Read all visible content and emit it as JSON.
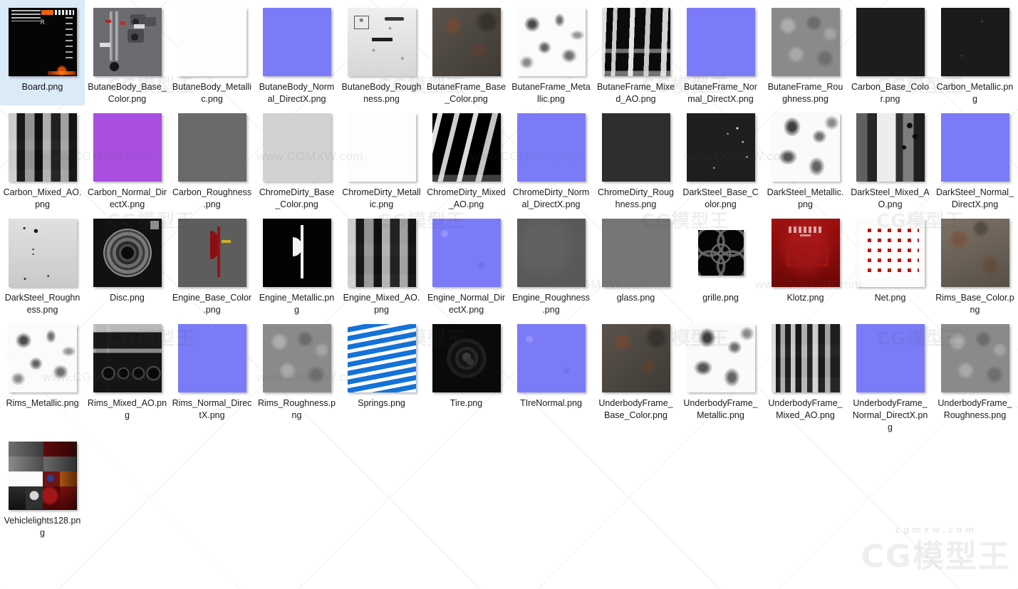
{
  "window": {
    "title": "Texture folder — icon view",
    "background": "#ffffff",
    "selection_color": "#dbeaf7"
  },
  "watermark": {
    "logo_text": "CG模型王",
    "logo_sub": "cgmxw.com",
    "tiles": [
      "CG模型王",
      "CG模型王",
      "CG模型王",
      "CG模型王",
      "CG模型王",
      "CG模型王",
      "CG模型王",
      "CG模型王",
      "CG模型王",
      "CG模型王",
      "CG模型王",
      "CG模型王"
    ],
    "urls": [
      "www.CGMXW.com",
      "www.CGMXW.com",
      "www.CGMXW.com",
      "www.CGMXW.com",
      "www.CGMXW.com",
      "www.CGMXW.com",
      "www.CGMXW.com",
      "www.CGMXW.com"
    ]
  },
  "files": [
    {
      "name": "Board.png",
      "selected": true,
      "thumb": "tx-board",
      "shape": "square"
    },
    {
      "name": "ButaneBody_Base_Color.png",
      "selected": false,
      "thumb": "tx-bbasecolor",
      "shape": "square"
    },
    {
      "name": "ButaneBody_Metallic.png",
      "selected": false,
      "thumb": "tx-white",
      "shape": "square"
    },
    {
      "name": "ButaneBody_Normal_DirectX.png",
      "selected": false,
      "thumb": "tx-normal",
      "shape": "square"
    },
    {
      "name": "ButaneBody_Roughness.png",
      "selected": false,
      "thumb": "tx-grunge-light",
      "shape": "square"
    },
    {
      "name": "ButaneFrame_Base_Color.png",
      "selected": false,
      "thumb": "tx-rust-dark",
      "shape": "square"
    },
    {
      "name": "ButaneFrame_Metallic.png",
      "selected": false,
      "thumb": "tx-speckle-white",
      "shape": "square"
    },
    {
      "name": "ButaneFrame_Mixed_AO.png",
      "selected": false,
      "thumb": "tx-ao-frame",
      "shape": "square"
    },
    {
      "name": "ButaneFrame_Normal_DirectX.png",
      "selected": false,
      "thumb": "tx-normal",
      "shape": "square"
    },
    {
      "name": "ButaneFrame_Roughness.png",
      "selected": false,
      "thumb": "tx-mid-rough",
      "shape": "square"
    },
    {
      "name": "Carbon_Base_Color.png",
      "selected": false,
      "thumb": "tx-near-black",
      "shape": "square"
    },
    {
      "name": "Carbon_Metallic.png",
      "selected": false,
      "thumb": "tx-near-black2",
      "shape": "square"
    },
    {
      "name": "Carbon_Mixed_AO.png",
      "selected": false,
      "thumb": "tx-ao-blocks",
      "shape": "square"
    },
    {
      "name": "Carbon_Normal_DirectX.png",
      "selected": false,
      "thumb": "tx-purple",
      "shape": "square"
    },
    {
      "name": "Carbon_Roughness.png",
      "selected": false,
      "thumb": "tx-gray-flat2",
      "shape": "square"
    },
    {
      "name": "ChromeDirty_Base_Color.png",
      "selected": false,
      "thumb": "tx-chrome-base",
      "shape": "square"
    },
    {
      "name": "ChromeDirty_Metallic.png",
      "selected": false,
      "thumb": "tx-white",
      "shape": "square"
    },
    {
      "name": "ChromeDirty_Mixed_AO.png",
      "selected": false,
      "thumb": "tx-ao-chrome",
      "shape": "square"
    },
    {
      "name": "ChromeDirty_Normal_DirectX.png",
      "selected": false,
      "thumb": "tx-normal",
      "shape": "square"
    },
    {
      "name": "ChromeDirty_Roughness.png",
      "selected": false,
      "thumb": "tx-gray-darkflat",
      "shape": "square"
    },
    {
      "name": "DarkSteel_Base_Color.png",
      "selected": false,
      "thumb": "tx-dk-speck",
      "shape": "square"
    },
    {
      "name": "DarkSteel_Metallic.png",
      "selected": false,
      "thumb": "tx-speckle-white2",
      "shape": "square"
    },
    {
      "name": "DarkSteel_Mixed_AO.png",
      "selected": false,
      "thumb": "tx-ao-darksteel",
      "shape": "square"
    },
    {
      "name": "DarkSteel_Normal_DirectX.png",
      "selected": false,
      "thumb": "tx-normal",
      "shape": "square"
    },
    {
      "name": "DarkSteel_Roughness.png",
      "selected": false,
      "thumb": "tx-offwhite-dots",
      "shape": "square"
    },
    {
      "name": "Disc.png",
      "selected": false,
      "thumb": "tx-disc",
      "shape": "square"
    },
    {
      "name": "Engine_Base_Color.png",
      "selected": false,
      "thumb": "tx-engine-base",
      "shape": "square"
    },
    {
      "name": "Engine_Metallic.png",
      "selected": false,
      "thumb": "tx-engine-metal",
      "shape": "square"
    },
    {
      "name": "Engine_Mixed_AO.png",
      "selected": false,
      "thumb": "tx-ao-blocks",
      "shape": "square"
    },
    {
      "name": "Engine_Normal_DirectX.png",
      "selected": false,
      "thumb": "tx-normal-noisy",
      "shape": "square"
    },
    {
      "name": "Engine_Roughness.png",
      "selected": false,
      "thumb": "tx-gray-dark2",
      "shape": "square"
    },
    {
      "name": "glass.png",
      "selected": false,
      "thumb": "tx-glass",
      "shape": "square"
    },
    {
      "name": "grille.png",
      "selected": false,
      "thumb": "tx-grille",
      "shape": "small"
    },
    {
      "name": "Klotz.png",
      "selected": false,
      "thumb": "tx-klotz",
      "shape": "square"
    },
    {
      "name": "Net.png",
      "selected": false,
      "thumb": "tx-net",
      "shape": "square"
    },
    {
      "name": "Rims_Base_Color.png",
      "selected": false,
      "thumb": "tx-rust-mid",
      "shape": "square"
    },
    {
      "name": "Rims_Metallic.png",
      "selected": false,
      "thumb": "tx-speckle-white",
      "shape": "square"
    },
    {
      "name": "Rims_Mixed_AO.png",
      "selected": false,
      "thumb": "tx-ao-rims",
      "shape": "square"
    },
    {
      "name": "Rims_Normal_DirectX.png",
      "selected": false,
      "thumb": "tx-normal",
      "shape": "square"
    },
    {
      "name": "Rims_Roughness.png",
      "selected": false,
      "thumb": "tx-mid-rough",
      "shape": "square"
    },
    {
      "name": "Springs.png",
      "selected": false,
      "thumb": "tx-springs",
      "shape": "square"
    },
    {
      "name": "Tire.png",
      "selected": false,
      "thumb": "tx-tire",
      "shape": "square"
    },
    {
      "name": "TIreNormal.png",
      "selected": false,
      "thumb": "tx-normal-noisy",
      "shape": "square"
    },
    {
      "name": "UnderbodyFrame_Base_Color.png",
      "selected": false,
      "thumb": "tx-rust-dark",
      "shape": "square"
    },
    {
      "name": "UnderbodyFrame_Metallic.png",
      "selected": false,
      "thumb": "tx-speckle-white2",
      "shape": "square"
    },
    {
      "name": "UnderbodyFrame_Mixed_AO.png",
      "selected": false,
      "thumb": "tx-ao-underbody",
      "shape": "square"
    },
    {
      "name": "UnderbodyFrame_Normal_DirectX.png",
      "selected": false,
      "thumb": "tx-normal",
      "shape": "square"
    },
    {
      "name": "UnderbodyFrame_Roughness.png",
      "selected": false,
      "thumb": "tx-mid-rough",
      "shape": "square"
    },
    {
      "name": "Vehiclelights128.png",
      "selected": false,
      "thumb": "tx-vlights",
      "shape": "square"
    }
  ],
  "summary": {
    "file_count": 49,
    "columns": 12,
    "rows": 5
  }
}
